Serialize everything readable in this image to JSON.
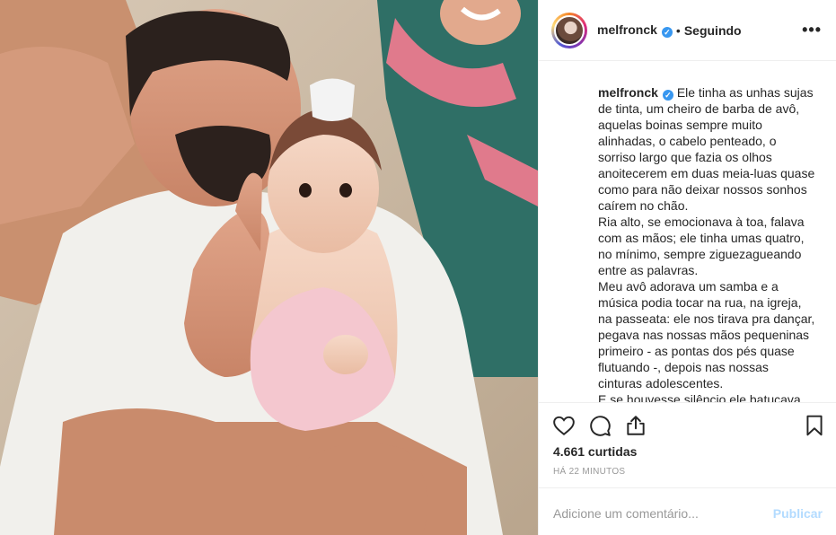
{
  "post": {
    "photo_alt": "Family photo",
    "header": {
      "username": "melfronck",
      "verified": true,
      "separator": "•",
      "follow_status": "Seguindo",
      "more_icon": "more-horizontal-icon"
    },
    "caption": {
      "username": "melfronck",
      "paragraphs": [
        "Ele tinha as unhas sujas de tinta, um cheiro de barba de avô, aquelas boinas sempre muito alinhadas, o cabelo penteado, o sorriso largo que fazia os olhos anoitecerem em duas meia-luas quase como para não deixar nossos sonhos caírem no chão.",
        "Ria alto, se emocionava à toa, falava com as mãos; ele tinha umas quatro, no mínimo, sempre ziguezagueando entre as palavras.",
        "Meu avô adorava um samba e a música podia tocar na rua, na igreja, na passeata: ele nos tirava pra dançar, pegava nas nossas mãos pequeninas primeiro - as pontas dos pés quase flutuando -, depois nas nossas cinturas adolescentes.",
        "E se houvesse silêncio ele batucava na"
      ]
    },
    "actions": {
      "like_icon": "heart-icon",
      "comment_icon": "comment-icon",
      "share_icon": "share-icon",
      "save_icon": "bookmark-icon"
    },
    "likes": "4.661 curtidas",
    "timestamp": "HÁ 22 MINUTOS",
    "comment": {
      "placeholder": "Adicione um comentário...",
      "publish_label": "Publicar"
    }
  },
  "colors": {
    "verified": "#3897f0",
    "publish_disabled": "#b3dbff",
    "muted_text": "#999999",
    "divider": "#efefef"
  }
}
